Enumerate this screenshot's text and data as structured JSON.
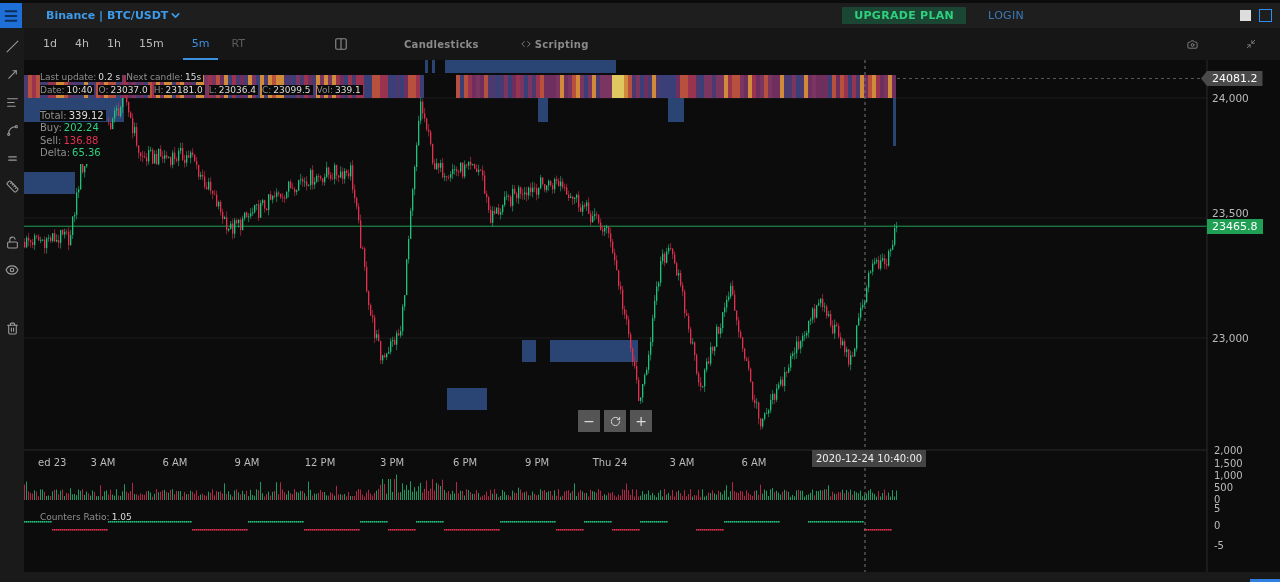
{
  "header": {
    "title": "Binance | BTC/USDT",
    "upgrade": "UPGRADE PLAN",
    "login": "LOGIN"
  },
  "timeframes": [
    {
      "label": "1d",
      "selected": false,
      "disabled": false
    },
    {
      "label": "4h",
      "selected": false,
      "disabled": false
    },
    {
      "label": "1h",
      "selected": false,
      "disabled": false
    },
    {
      "label": "15m",
      "selected": false,
      "disabled": false
    },
    {
      "label": "5m",
      "selected": true,
      "disabled": false
    },
    {
      "label": "RT",
      "selected": false,
      "disabled": true
    }
  ],
  "toolbar": {
    "chart_type": "Candlesticks",
    "scripting": "Scripting"
  },
  "legend": {
    "status": [
      {
        "label": "Last update:",
        "value": "0.2 s"
      },
      {
        "label": "Next candle:",
        "value": "15s"
      }
    ],
    "ohlc": [
      {
        "label": "Date:",
        "value": "10:40"
      },
      {
        "label": "O:",
        "value": "23037.0"
      },
      {
        "label": "H:",
        "value": "23181.0"
      },
      {
        "label": "L:",
        "value": "23036.4"
      },
      {
        "label": "C:",
        "value": "23099.5"
      },
      {
        "label": "Vol:",
        "value": "339.1"
      }
    ],
    "stats": [
      {
        "label": "Total:",
        "value": "339.12",
        "color": "#dddddd"
      },
      {
        "label": "Buy:",
        "value": "202.24",
        "color": "#2fd07f"
      },
      {
        "label": "Sell:",
        "value": "136.88",
        "color": "#e0314f"
      },
      {
        "label": "Delta:",
        "value": "65.36",
        "color": "#2fd07f"
      }
    ]
  },
  "price_axis": [
    "24,000",
    "23,500",
    "23,000"
  ],
  "price_tags": [
    {
      "value": "24081.2",
      "kind": "marker"
    },
    {
      "value": "23465.8",
      "kind": "last"
    }
  ],
  "zoom_controls": {
    "zoom_out": "−",
    "zoom_in": "+"
  },
  "time_axis": [
    "ed 23",
    "3 AM",
    "6 AM",
    "9 AM",
    "12 PM",
    "3 PM",
    "6 PM",
    "9 PM",
    "Thu 24",
    "3 AM",
    "6 AM"
  ],
  "crosshair_time": "2020-12-24 10:40:00",
  "volume_axis": [
    "2,000",
    "1,500",
    "1,000",
    "500",
    "0"
  ],
  "ratio": {
    "label": "Counters Ratio:",
    "value": "1.05"
  },
  "ratio_axis": [
    "5",
    "0",
    "-5"
  ]
}
